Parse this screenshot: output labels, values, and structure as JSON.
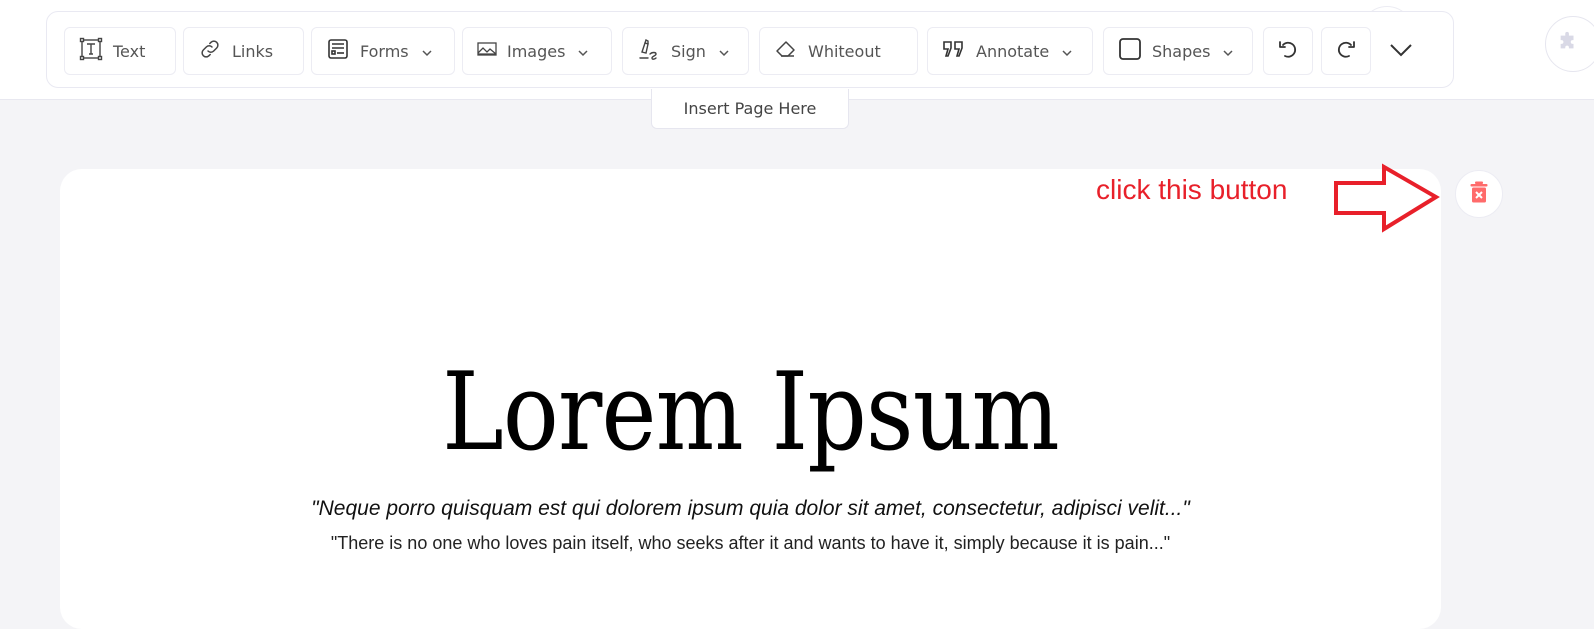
{
  "toolbar": {
    "buttons": [
      {
        "id": "text",
        "label": "Text",
        "icon": "text-box-icon",
        "dropdown": false
      },
      {
        "id": "links",
        "label": "Links",
        "icon": "link-icon",
        "dropdown": false
      },
      {
        "id": "forms",
        "label": "Forms",
        "icon": "form-icon",
        "dropdown": true
      },
      {
        "id": "images",
        "label": "Images",
        "icon": "image-icon",
        "dropdown": true
      },
      {
        "id": "sign",
        "label": "Sign",
        "icon": "signature-pen-icon",
        "dropdown": true
      },
      {
        "id": "whiteout",
        "label": "Whiteout",
        "icon": "eraser-icon",
        "dropdown": false
      },
      {
        "id": "annotate",
        "label": "Annotate",
        "icon": "quote-icon",
        "dropdown": true
      },
      {
        "id": "shapes",
        "label": "Shapes",
        "icon": "square-icon",
        "dropdown": true
      }
    ],
    "undo_icon": "undo-icon",
    "redo_icon": "redo-icon",
    "more_icon": "chevron-down-icon"
  },
  "plugin_icon": "puzzle-icon",
  "insert_page": {
    "label": "Insert Page Here"
  },
  "page": {
    "title": "Lorem Ipsum",
    "quote": "\"Neque porro quisquam est qui dolorem ipsum quia dolor sit amet, consectetur, adipisci velit...\"",
    "subtitle": "\"There is no one who loves pain itself, who seeks after it and wants to have it, simply because it is pain...\""
  },
  "annotation": {
    "text": "click this button",
    "color": "#e8202a"
  },
  "delete_page": {
    "icon": "trash-x-icon",
    "color": "#ff6b6b"
  }
}
